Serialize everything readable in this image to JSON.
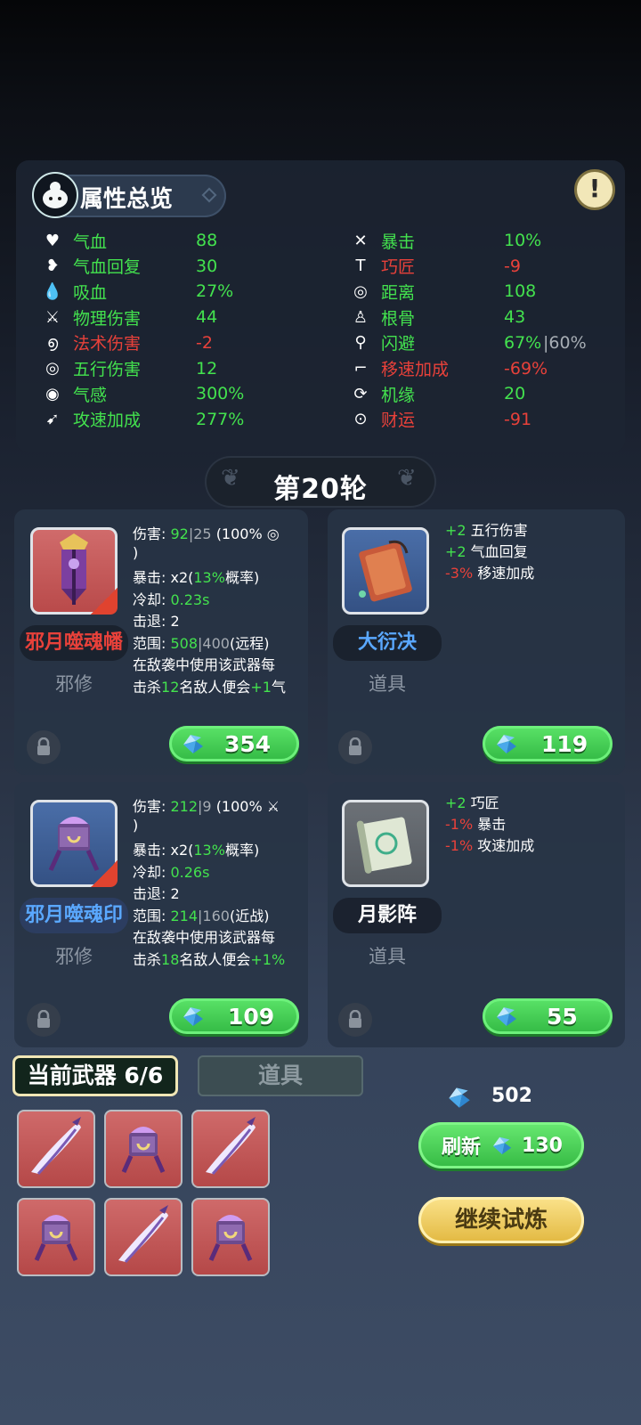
{
  "attributes": {
    "title": "属性总览",
    "left": [
      {
        "icon": "heart-icon",
        "name": "气血",
        "value": "88",
        "name_color": "green",
        "value_color": "green"
      },
      {
        "icon": "heart-regen-icon",
        "name": "气血回复",
        "value": "30",
        "name_color": "green",
        "value_color": "green"
      },
      {
        "icon": "drop-icon",
        "name": "吸血",
        "value": "27%",
        "name_color": "green",
        "value_color": "green"
      },
      {
        "icon": "sword-icon",
        "name": "物理伤害",
        "value": "44",
        "name_color": "green",
        "value_color": "green"
      },
      {
        "icon": "spiral-icon",
        "name": "法术伤害",
        "value": "-2",
        "name_color": "red",
        "value_color": "red"
      },
      {
        "icon": "target-spiral-icon",
        "name": "五行伤害",
        "value": "12",
        "name_color": "green",
        "value_color": "green"
      },
      {
        "icon": "aura-icon",
        "name": "气感",
        "value": "300%",
        "name_color": "green",
        "value_color": "green"
      },
      {
        "icon": "speed-icon",
        "name": "攻速加成",
        "value": "277%",
        "name_color": "green",
        "value_color": "green"
      }
    ],
    "right": [
      {
        "icon": "crit-icon",
        "name": "暴击",
        "value": "10%",
        "name_color": "green",
        "value_color": "green"
      },
      {
        "icon": "hammer-icon",
        "name": "巧匠",
        "value": "-9",
        "name_color": "red",
        "value_color": "red"
      },
      {
        "icon": "range-icon",
        "name": "距离",
        "value": "108",
        "name_color": "green",
        "value_color": "green"
      },
      {
        "icon": "body-icon",
        "name": "根骨",
        "value": "43",
        "name_color": "green",
        "value_color": "green"
      },
      {
        "icon": "dodge-icon",
        "name": "闪避",
        "value": "67%",
        "value_extra": "|60%",
        "name_color": "green",
        "value_color": "green"
      },
      {
        "icon": "boot-icon",
        "name": "移速加成",
        "value": "-69%",
        "name_color": "red",
        "value_color": "red"
      },
      {
        "icon": "luck-icon",
        "name": "机缘",
        "value": "20",
        "name_color": "green",
        "value_color": "green"
      },
      {
        "icon": "coin-icon",
        "name": "财运",
        "value": "-91",
        "name_color": "red",
        "value_color": "red"
      }
    ]
  },
  "round": {
    "label": "第20轮"
  },
  "shop": {
    "weapon1": {
      "name": "邪月噬魂幡",
      "type": "邪修",
      "price": "354",
      "lines": [
        [
          {
            "t": "伤害: "
          },
          {
            "t": "92",
            "c": "green"
          },
          {
            "t": "|25 ",
            "c": "grey"
          },
          {
            "t": "(100% ◎"
          }
        ],
        [
          {
            "t": ")"
          }
        ],
        [
          {
            "t": "暴击: x2("
          },
          {
            "t": "13%",
            "c": "green"
          },
          {
            "t": "概率)"
          }
        ],
        [
          {
            "t": "冷却: "
          },
          {
            "t": "0.23s",
            "c": "green"
          }
        ],
        [
          {
            "t": "击退: 2"
          }
        ],
        [
          {
            "t": "范围: "
          },
          {
            "t": "508",
            "c": "green"
          },
          {
            "t": "|400",
            "c": "grey"
          },
          {
            "t": "(远程)"
          }
        ],
        [
          {
            "t": "在敌袭中使用该武器每"
          }
        ],
        [
          {
            "t": "击杀"
          },
          {
            "t": "12",
            "c": "green"
          },
          {
            "t": "名敌人便会"
          },
          {
            "t": "+1",
            "c": "green"
          },
          {
            "t": "气"
          }
        ]
      ]
    },
    "item1": {
      "name": "大衍决",
      "type": "道具",
      "price": "119",
      "mods": [
        [
          {
            "t": "+2",
            "c": "green"
          },
          {
            "t": " 五行伤害"
          }
        ],
        [
          {
            "t": "+2",
            "c": "green"
          },
          {
            "t": " 气血回复"
          }
        ],
        [
          {
            "t": "-3%",
            "c": "red"
          },
          {
            "t": " 移速加成"
          }
        ]
      ]
    },
    "weapon2": {
      "name": "邪月噬魂印",
      "type": "邪修",
      "price": "109",
      "lines": [
        [
          {
            "t": "伤害: "
          },
          {
            "t": "212",
            "c": "green"
          },
          {
            "t": "|9 ",
            "c": "grey"
          },
          {
            "t": "(100% ⚔"
          }
        ],
        [
          {
            "t": ")"
          }
        ],
        [
          {
            "t": "暴击: x2("
          },
          {
            "t": "13%",
            "c": "green"
          },
          {
            "t": "概率)"
          }
        ],
        [
          {
            "t": "冷却: "
          },
          {
            "t": "0.26s",
            "c": "green"
          }
        ],
        [
          {
            "t": "击退: 2"
          }
        ],
        [
          {
            "t": "范围: "
          },
          {
            "t": "214",
            "c": "green"
          },
          {
            "t": "|160",
            "c": "grey"
          },
          {
            "t": "(近战)"
          }
        ],
        [
          {
            "t": "在敌袭中使用该武器每"
          }
        ],
        [
          {
            "t": "击杀"
          },
          {
            "t": "18",
            "c": "green"
          },
          {
            "t": "名敌人便会"
          },
          {
            "t": "+1%",
            "c": "green"
          }
        ]
      ]
    },
    "item2": {
      "name": "月影阵",
      "type": "道具",
      "price": "55",
      "mods": [
        [
          {
            "t": "+2",
            "c": "green"
          },
          {
            "t": " 巧匠"
          }
        ],
        [
          {
            "t": "-1%",
            "c": "red"
          },
          {
            "t": " 暴击"
          }
        ],
        [
          {
            "t": "-1%",
            "c": "red"
          },
          {
            "t": " 攻速加成"
          }
        ]
      ]
    }
  },
  "tabs": {
    "weapons": "当前武器 6/6",
    "items": "道具"
  },
  "slots": [
    "scythe-weapon",
    "seal-weapon",
    "scythe-weapon",
    "seal-weapon",
    "scythe-weapon",
    "seal-weapon"
  ],
  "currency": {
    "amount": "502"
  },
  "buttons": {
    "refresh": "刷新",
    "refresh_cost": "130",
    "continue": "继续试炼"
  },
  "colors": {
    "green": "#43e24e",
    "red": "#e8413a",
    "grey": "#a7adb4",
    "price_green": "#33b944",
    "continue_gold": "#e2b840"
  }
}
